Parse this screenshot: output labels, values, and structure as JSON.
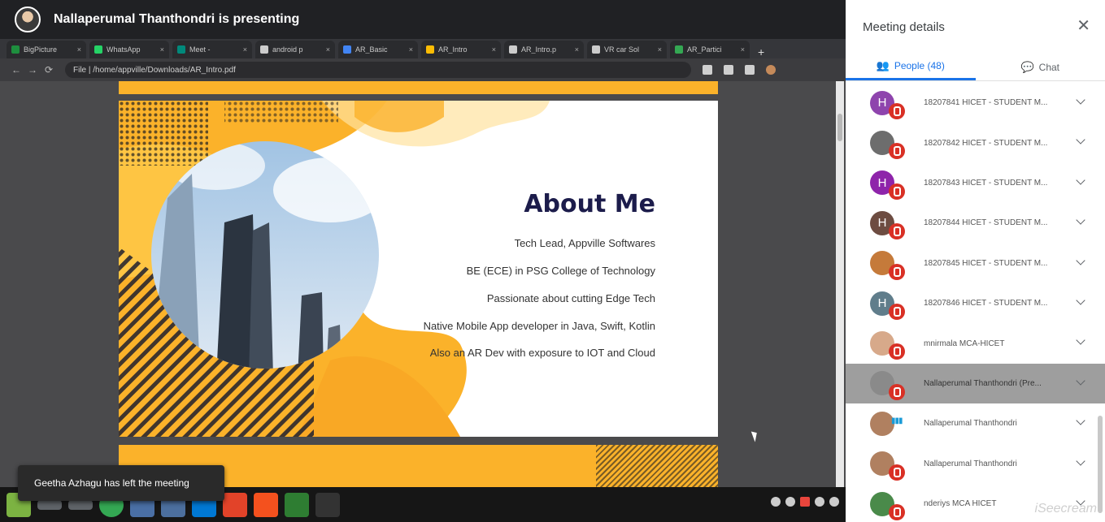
{
  "presenter": {
    "text": "Nallaperumal Thanthondri is presenting"
  },
  "browser": {
    "tabs": [
      {
        "label": "BigPicture",
        "color": "#1e8e3e"
      },
      {
        "label": "WhatsApp",
        "color": "#25d366"
      },
      {
        "label": "Meet -",
        "color": "#00897b"
      },
      {
        "label": "android p",
        "color": "#cccccc"
      },
      {
        "label": "AR_Basic",
        "color": "#4285f4"
      },
      {
        "label": "AR_Intro",
        "color": "#fbbc04"
      },
      {
        "label": "AR_Intro.p",
        "color": "#cccccc"
      },
      {
        "label": "VR car Sol",
        "color": "#cccccc"
      },
      {
        "label": "AR_Partici",
        "color": "#34a853"
      }
    ],
    "new_tab": "+",
    "url": "File | /home/appville/Downloads/AR_Intro.pdf"
  },
  "slide": {
    "title": "About Me",
    "lines": [
      "Tech Lead, Appville Softwares",
      "BE (ECE) in PSG College of Technology",
      "Passionate about cutting Edge Tech",
      "Native Mobile App developer in Java, Swift, Kotlin",
      "Also an AR Dev with exposure to IOT and Cloud"
    ]
  },
  "toast": {
    "text": "Geetha Azhagu has left the meeting"
  },
  "panel": {
    "title": "Meeting details",
    "close": "✕",
    "tabs": {
      "people": "People (48)",
      "chat": "Chat"
    },
    "people": [
      {
        "name": "18207841 HICET - STUDENT M...",
        "initial": "H",
        "color": "#8e44ad",
        "mic": "muted"
      },
      {
        "name": "18207842 HICET - STUDENT M...",
        "initial": "",
        "color": "#6d6d6d",
        "mic": "muted"
      },
      {
        "name": "18207843 HICET - STUDENT M...",
        "initial": "H",
        "color": "#8e24aa",
        "mic": "muted"
      },
      {
        "name": "18207844 HICET - STUDENT M...",
        "initial": "H",
        "color": "#6d4c41",
        "mic": "muted"
      },
      {
        "name": "18207845 HICET - STUDENT M...",
        "initial": "",
        "color": "#c57a3a",
        "mic": "muted"
      },
      {
        "name": "18207846 HICET - STUDENT M...",
        "initial": "H",
        "color": "#607d8b",
        "mic": "muted"
      },
      {
        "name": "mnirmala MCA-HICET",
        "initial": "",
        "color": "#d7a98a",
        "mic": "muted"
      },
      {
        "name": "Nallaperumal Thanthondri (Pre...",
        "initial": "",
        "color": "#8a8a8a",
        "mic": "muted",
        "highlighted": true
      },
      {
        "name": "Nallaperumal Thanthondri",
        "initial": "",
        "color": "#b08060",
        "mic": "speaking"
      },
      {
        "name": "Nallaperumal Thanthondri",
        "initial": "",
        "color": "#b08060",
        "mic": "muted"
      },
      {
        "name": "nderiys MCA HICET",
        "initial": "",
        "color": "#4a8a4a",
        "mic": "muted"
      }
    ]
  },
  "watermark": "iSeecream"
}
